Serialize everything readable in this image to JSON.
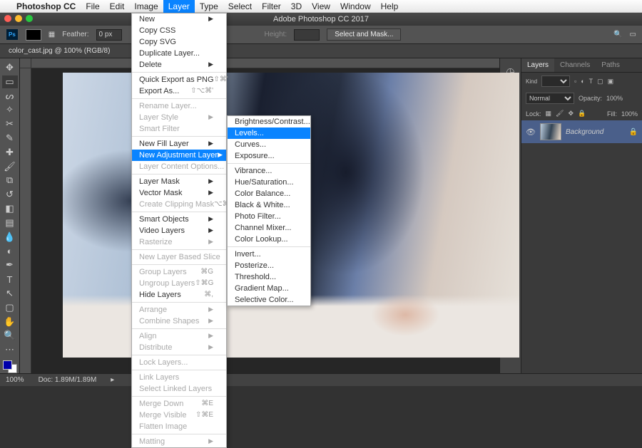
{
  "menubar": {
    "app": "Photoshop CC",
    "items": [
      "File",
      "Edit",
      "Image",
      "Layer",
      "Type",
      "Select",
      "Filter",
      "3D",
      "View",
      "Window",
      "Help"
    ],
    "open_index": 3
  },
  "window_title": "Adobe Photoshop CC 2017",
  "options_bar": {
    "feather_label": "Feather:",
    "feather_value": "0 px",
    "height_label": "Height:",
    "select_mask": "Select and Mask..."
  },
  "document_tab": "color_cast.jpg @ 100% (RGB/8)",
  "layers_panel": {
    "tabs": [
      "Layers",
      "Channels",
      "Paths"
    ],
    "blend_mode": "Normal",
    "opacity_label": "Opacity:",
    "opacity_value": "100%",
    "lock_label": "Lock:",
    "fill_label": "Fill:",
    "fill_value": "100%",
    "kind_label": "Kind",
    "layer_name": "Background"
  },
  "status": {
    "zoom": "100%",
    "doc": "Doc: 1.89M/1.89M"
  },
  "layer_menu": [
    {
      "label": "New",
      "arrow": true
    },
    {
      "label": "Copy CSS"
    },
    {
      "label": "Copy SVG"
    },
    {
      "label": "Duplicate Layer..."
    },
    {
      "label": "Delete",
      "arrow": true
    },
    {
      "sep": true
    },
    {
      "label": "Quick Export as PNG",
      "shortcut": "⇧⌘'"
    },
    {
      "label": "Export As...",
      "shortcut": "⇧⌥⌘'"
    },
    {
      "sep": true
    },
    {
      "label": "Rename Layer...",
      "disabled": true
    },
    {
      "label": "Layer Style",
      "arrow": true,
      "disabled": true
    },
    {
      "label": "Smart Filter",
      "disabled": true
    },
    {
      "sep": true
    },
    {
      "label": "New Fill Layer",
      "arrow": true
    },
    {
      "label": "New Adjustment Layer",
      "arrow": true,
      "highlight": true
    },
    {
      "label": "Layer Content Options...",
      "disabled": true
    },
    {
      "sep": true
    },
    {
      "label": "Layer Mask",
      "arrow": true
    },
    {
      "label": "Vector Mask",
      "arrow": true
    },
    {
      "label": "Create Clipping Mask",
      "shortcut": "⌥⌘G",
      "disabled": true
    },
    {
      "sep": true
    },
    {
      "label": "Smart Objects",
      "arrow": true
    },
    {
      "label": "Video Layers",
      "arrow": true
    },
    {
      "label": "Rasterize",
      "arrow": true,
      "disabled": true
    },
    {
      "sep": true
    },
    {
      "label": "New Layer Based Slice",
      "disabled": true
    },
    {
      "sep": true
    },
    {
      "label": "Group Layers",
      "shortcut": "⌘G",
      "disabled": true
    },
    {
      "label": "Ungroup Layers",
      "shortcut": "⇧⌘G",
      "disabled": true
    },
    {
      "label": "Hide Layers",
      "shortcut": "⌘,"
    },
    {
      "sep": true
    },
    {
      "label": "Arrange",
      "arrow": true,
      "disabled": true
    },
    {
      "label": "Combine Shapes",
      "arrow": true,
      "disabled": true
    },
    {
      "sep": true
    },
    {
      "label": "Align",
      "arrow": true,
      "disabled": true
    },
    {
      "label": "Distribute",
      "arrow": true,
      "disabled": true
    },
    {
      "sep": true
    },
    {
      "label": "Lock Layers...",
      "disabled": true
    },
    {
      "sep": true
    },
    {
      "label": "Link Layers",
      "disabled": true
    },
    {
      "label": "Select Linked Layers",
      "disabled": true
    },
    {
      "sep": true
    },
    {
      "label": "Merge Down",
      "shortcut": "⌘E",
      "disabled": true
    },
    {
      "label": "Merge Visible",
      "shortcut": "⇧⌘E",
      "disabled": true
    },
    {
      "label": "Flatten Image",
      "disabled": true
    },
    {
      "sep": true
    },
    {
      "label": "Matting",
      "arrow": true,
      "disabled": true
    }
  ],
  "adjustment_submenu": [
    {
      "label": "Brightness/Contrast..."
    },
    {
      "label": "Levels...",
      "highlight": true
    },
    {
      "label": "Curves..."
    },
    {
      "label": "Exposure..."
    },
    {
      "sep": true
    },
    {
      "label": "Vibrance..."
    },
    {
      "label": "Hue/Saturation..."
    },
    {
      "label": "Color Balance..."
    },
    {
      "label": "Black & White..."
    },
    {
      "label": "Photo Filter..."
    },
    {
      "label": "Channel Mixer..."
    },
    {
      "label": "Color Lookup..."
    },
    {
      "sep": true
    },
    {
      "label": "Invert..."
    },
    {
      "label": "Posterize..."
    },
    {
      "label": "Threshold..."
    },
    {
      "label": "Gradient Map..."
    },
    {
      "label": "Selective Color..."
    }
  ]
}
